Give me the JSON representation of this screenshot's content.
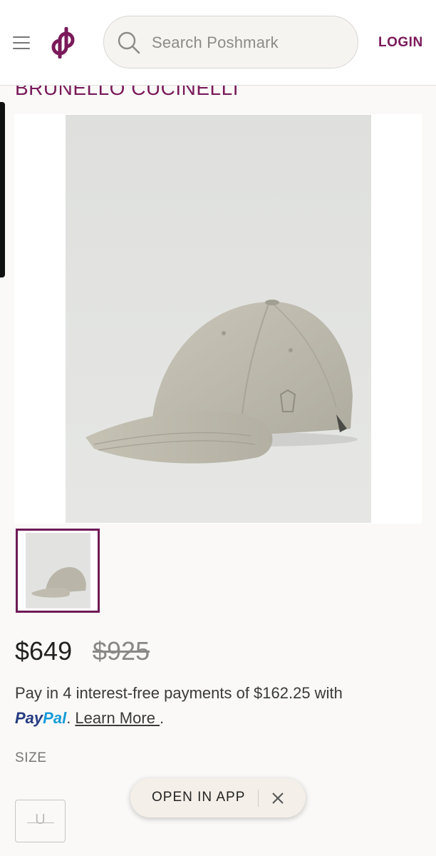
{
  "header": {
    "search_placeholder": "Search Poshmark",
    "login_label": "LOGIN"
  },
  "listing": {
    "brand": "BRUNELLO CUCINELLI",
    "price": "$649",
    "original_price": "$925",
    "installments_text": "Pay in 4 interest-free payments of $162.25 with",
    "paypal_brand_a": "Pay",
    "paypal_brand_b": "Pal",
    "learn_more_label": "Learn More ",
    "after_link": ".",
    "size_label": "SIZE",
    "size_value": "U"
  },
  "banner": {
    "open_app_label": "OPEN IN APP"
  },
  "colors": {
    "brand_plum": "#7a1a5a",
    "background": "#faf9f8"
  },
  "icons": [
    "menu-icon",
    "poshmark-logo-icon",
    "search-icon",
    "close-icon"
  ]
}
